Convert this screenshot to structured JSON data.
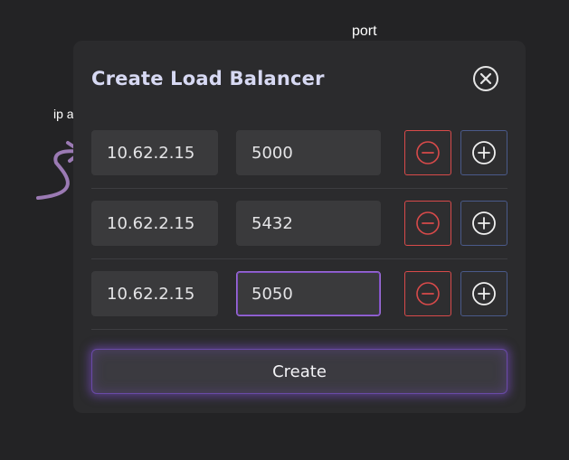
{
  "annotations": {
    "port": "port",
    "ip": "ip add"
  },
  "modal": {
    "title": "Create Load Balancer",
    "close_icon": "close-x-circle-icon",
    "rows": [
      {
        "ip": "10.62.2.15",
        "port": "5000"
      },
      {
        "ip": "10.62.2.15",
        "port": "5432"
      },
      {
        "ip": "10.62.2.15",
        "port": "5050"
      }
    ],
    "remove_icon": "minus-circle-icon",
    "add_icon": "plus-circle-icon",
    "create_label": "Create"
  },
  "colors": {
    "background": "#232325",
    "modal_bg": "#2b2b2d",
    "title": "#d7d9f3",
    "remove": "#d84a4a",
    "add_border": "#4a5a8a",
    "accent_purple": "#9a6bd6",
    "arrow": "#9b7ab4"
  }
}
